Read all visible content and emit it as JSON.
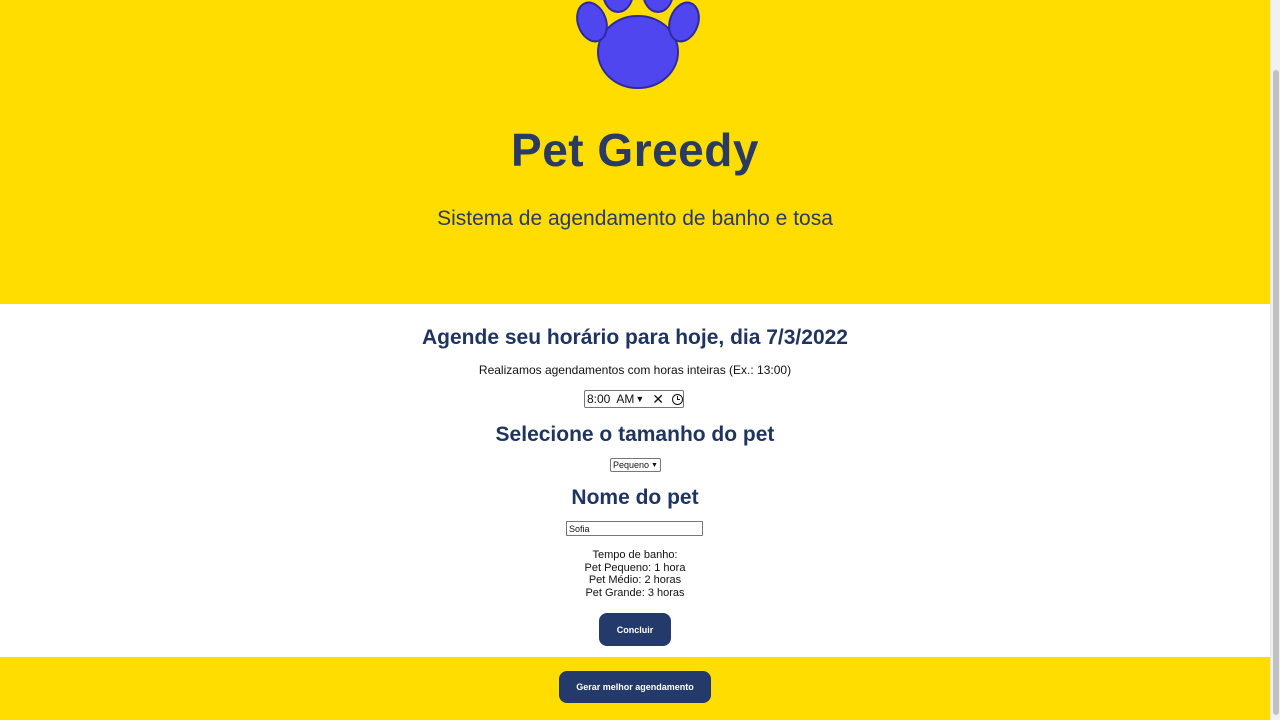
{
  "header": {
    "brand_title": "Pet Greedy",
    "brand_subtitle": "Sistema de agendamento de banho e tosa",
    "logo_icon": "paw-icon",
    "logo_color": "#5046f0",
    "background": "#ffdd00"
  },
  "schedule": {
    "title": "Agende seu horário para hoje, dia 7/3/2022",
    "hint": "Realizamos agendamentos com horas inteiras (Ex.: 13:00)",
    "time_value": "8:00",
    "time_period": "AM"
  },
  "size": {
    "title": "Selecione o tamanho do pet",
    "selected": "Pequeno"
  },
  "pet_name": {
    "title": "Nome do pet",
    "value": "Sofia"
  },
  "bath_times": {
    "heading": "Tempo de banho:",
    "small": "Pet Pequeno: 1 hora",
    "medium": "Pet Médio: 2 horas",
    "large": "Pet Grande: 3 horas"
  },
  "buttons": {
    "conclude": "Concluir",
    "generate": "Gerar melhor agendamento",
    "color": "#243a6b"
  }
}
